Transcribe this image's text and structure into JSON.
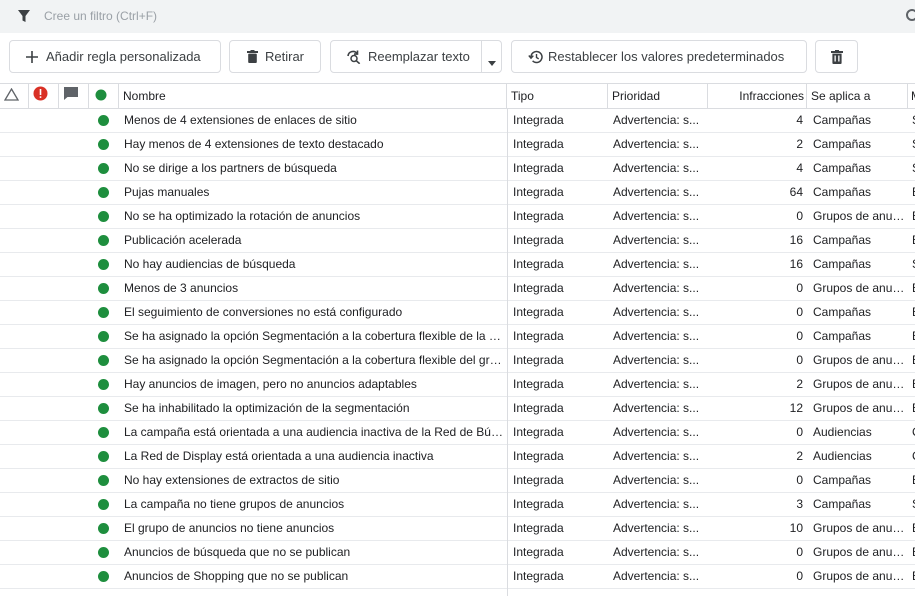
{
  "filter": {
    "placeholder": "Cree un filtro (Ctrl+F)"
  },
  "toolbar": {
    "add_rule": "Añadir regla personalizada",
    "remove": "Retirar",
    "replace_text": "Reemplazar texto",
    "restore_defaults": "Restablecer los valores predeterminados"
  },
  "columns": {
    "name": "Nombre",
    "type": "Tipo",
    "priority": "Prioridad",
    "violations": "Infracciones",
    "applies_to": "Se aplica a",
    "extra": "M"
  },
  "colors": {
    "status_green": "#1e8e3e",
    "error_red": "#d93025"
  },
  "rows": [
    {
      "name": "Menos de 4 extensiones de enlaces de sitio",
      "type": "Integrada",
      "priority": "Advertencia: s...",
      "violations": "4",
      "applies_to": "Campañas",
      "extra": "S"
    },
    {
      "name": "Hay menos de 4 extensiones de texto destacado",
      "type": "Integrada",
      "priority": "Advertencia: s...",
      "violations": "2",
      "applies_to": "Campañas",
      "extra": "S"
    },
    {
      "name": "No se dirige a los partners de búsqueda",
      "type": "Integrada",
      "priority": "Advertencia: s...",
      "violations": "4",
      "applies_to": "Campañas",
      "extra": "S"
    },
    {
      "name": "Pujas manuales",
      "type": "Integrada",
      "priority": "Advertencia: s...",
      "violations": "64",
      "applies_to": "Campañas",
      "extra": "E"
    },
    {
      "name": "No se ha optimizado la rotación de anuncios",
      "type": "Integrada",
      "priority": "Advertencia: s...",
      "violations": "0",
      "applies_to": "Grupos de anuncios",
      "extra": "E"
    },
    {
      "name": "Publicación acelerada",
      "type": "Integrada",
      "priority": "Advertencia: s...",
      "violations": "16",
      "applies_to": "Campañas",
      "extra": "E"
    },
    {
      "name": "No hay audiencias de búsqueda",
      "type": "Integrada",
      "priority": "Advertencia: s...",
      "violations": "16",
      "applies_to": "Campañas",
      "extra": "S"
    },
    {
      "name": "Menos de 3 anuncios",
      "type": "Integrada",
      "priority": "Advertencia: s...",
      "violations": "0",
      "applies_to": "Grupos de anuncios",
      "extra": "E"
    },
    {
      "name": "El seguimiento de conversiones no está configurado",
      "type": "Integrada",
      "priority": "Advertencia: s...",
      "violations": "0",
      "applies_to": "Campañas",
      "extra": "E"
    },
    {
      "name": "Se ha asignado la opción Segmentación a la cobertura flexible de la campaña",
      "type": "Integrada",
      "priority": "Advertencia: s...",
      "violations": "0",
      "applies_to": "Campañas",
      "extra": "E"
    },
    {
      "name": "Se ha asignado la opción Segmentación a la cobertura flexible del grupo de anuncios",
      "type": "Integrada",
      "priority": "Advertencia: s...",
      "violations": "0",
      "applies_to": "Grupos de anuncios",
      "extra": "E"
    },
    {
      "name": "Hay anuncios de imagen, pero no anuncios adaptables",
      "type": "Integrada",
      "priority": "Advertencia: s...",
      "violations": "2",
      "applies_to": "Grupos de anuncios",
      "extra": "E"
    },
    {
      "name": "Se ha inhabilitado la optimización de la segmentación",
      "type": "Integrada",
      "priority": "Advertencia: s...",
      "violations": "12",
      "applies_to": "Grupos de anuncios",
      "extra": "E"
    },
    {
      "name": "La campaña está orientada a una audiencia inactiva de la Red de Búsqueda",
      "type": "Integrada",
      "priority": "Advertencia: s...",
      "violations": "0",
      "applies_to": "Audiencias",
      "extra": "C"
    },
    {
      "name": "La Red de Display está orientada a una audiencia inactiva",
      "type": "Integrada",
      "priority": "Advertencia: s...",
      "violations": "2",
      "applies_to": "Audiencias",
      "extra": "C"
    },
    {
      "name": "No hay extensiones de extractos de sitio",
      "type": "Integrada",
      "priority": "Advertencia: s...",
      "violations": "0",
      "applies_to": "Campañas",
      "extra": "E"
    },
    {
      "name": "La campaña no tiene grupos de anuncios",
      "type": "Integrada",
      "priority": "Advertencia: s...",
      "violations": "3",
      "applies_to": "Campañas",
      "extra": "S"
    },
    {
      "name": "El grupo de anuncios no tiene anuncios",
      "type": "Integrada",
      "priority": "Advertencia: s...",
      "violations": "10",
      "applies_to": "Grupos de anuncios",
      "extra": "E"
    },
    {
      "name": "Anuncios de búsqueda que no se publican",
      "type": "Integrada",
      "priority": "Advertencia: s...",
      "violations": "0",
      "applies_to": "Grupos de anuncios",
      "extra": "E"
    },
    {
      "name": "Anuncios de Shopping que no se publican",
      "type": "Integrada",
      "priority": "Advertencia: s...",
      "violations": "0",
      "applies_to": "Grupos de anuncios",
      "extra": "E"
    }
  ]
}
